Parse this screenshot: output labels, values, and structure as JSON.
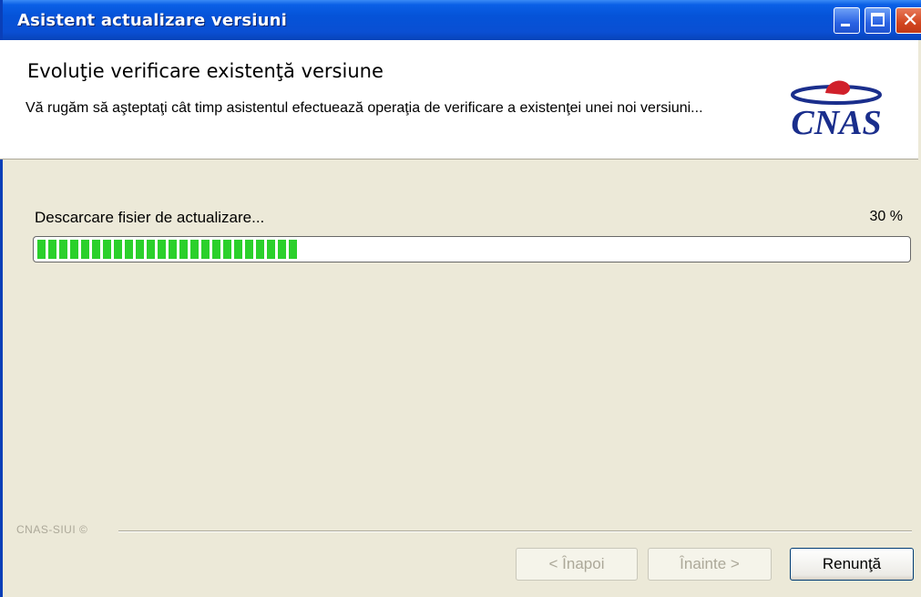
{
  "window": {
    "title": "Asistent actualizare versiuni"
  },
  "header": {
    "title": "Evoluţie verificare existenţă versiune",
    "description": "Vă rugăm să aşteptaţi cât timp asistentul efectuează operaţia de verificare a existenţei unei noi versiuni...",
    "logo_text": "CNAS"
  },
  "progress": {
    "label": "Descarcare fisier de actualizare...",
    "percent_text": "30 %",
    "value": 0.3
  },
  "footer": {
    "brand": "CNAS-SIUI ©"
  },
  "buttons": {
    "back": "< Înapoi",
    "next": "Înainte >",
    "cancel": "Renunţă"
  },
  "colors": {
    "titlebar": "#0553d8",
    "progress": "#2bd02b",
    "logo_red": "#d0202a",
    "logo_blue": "#1a2e8c"
  }
}
